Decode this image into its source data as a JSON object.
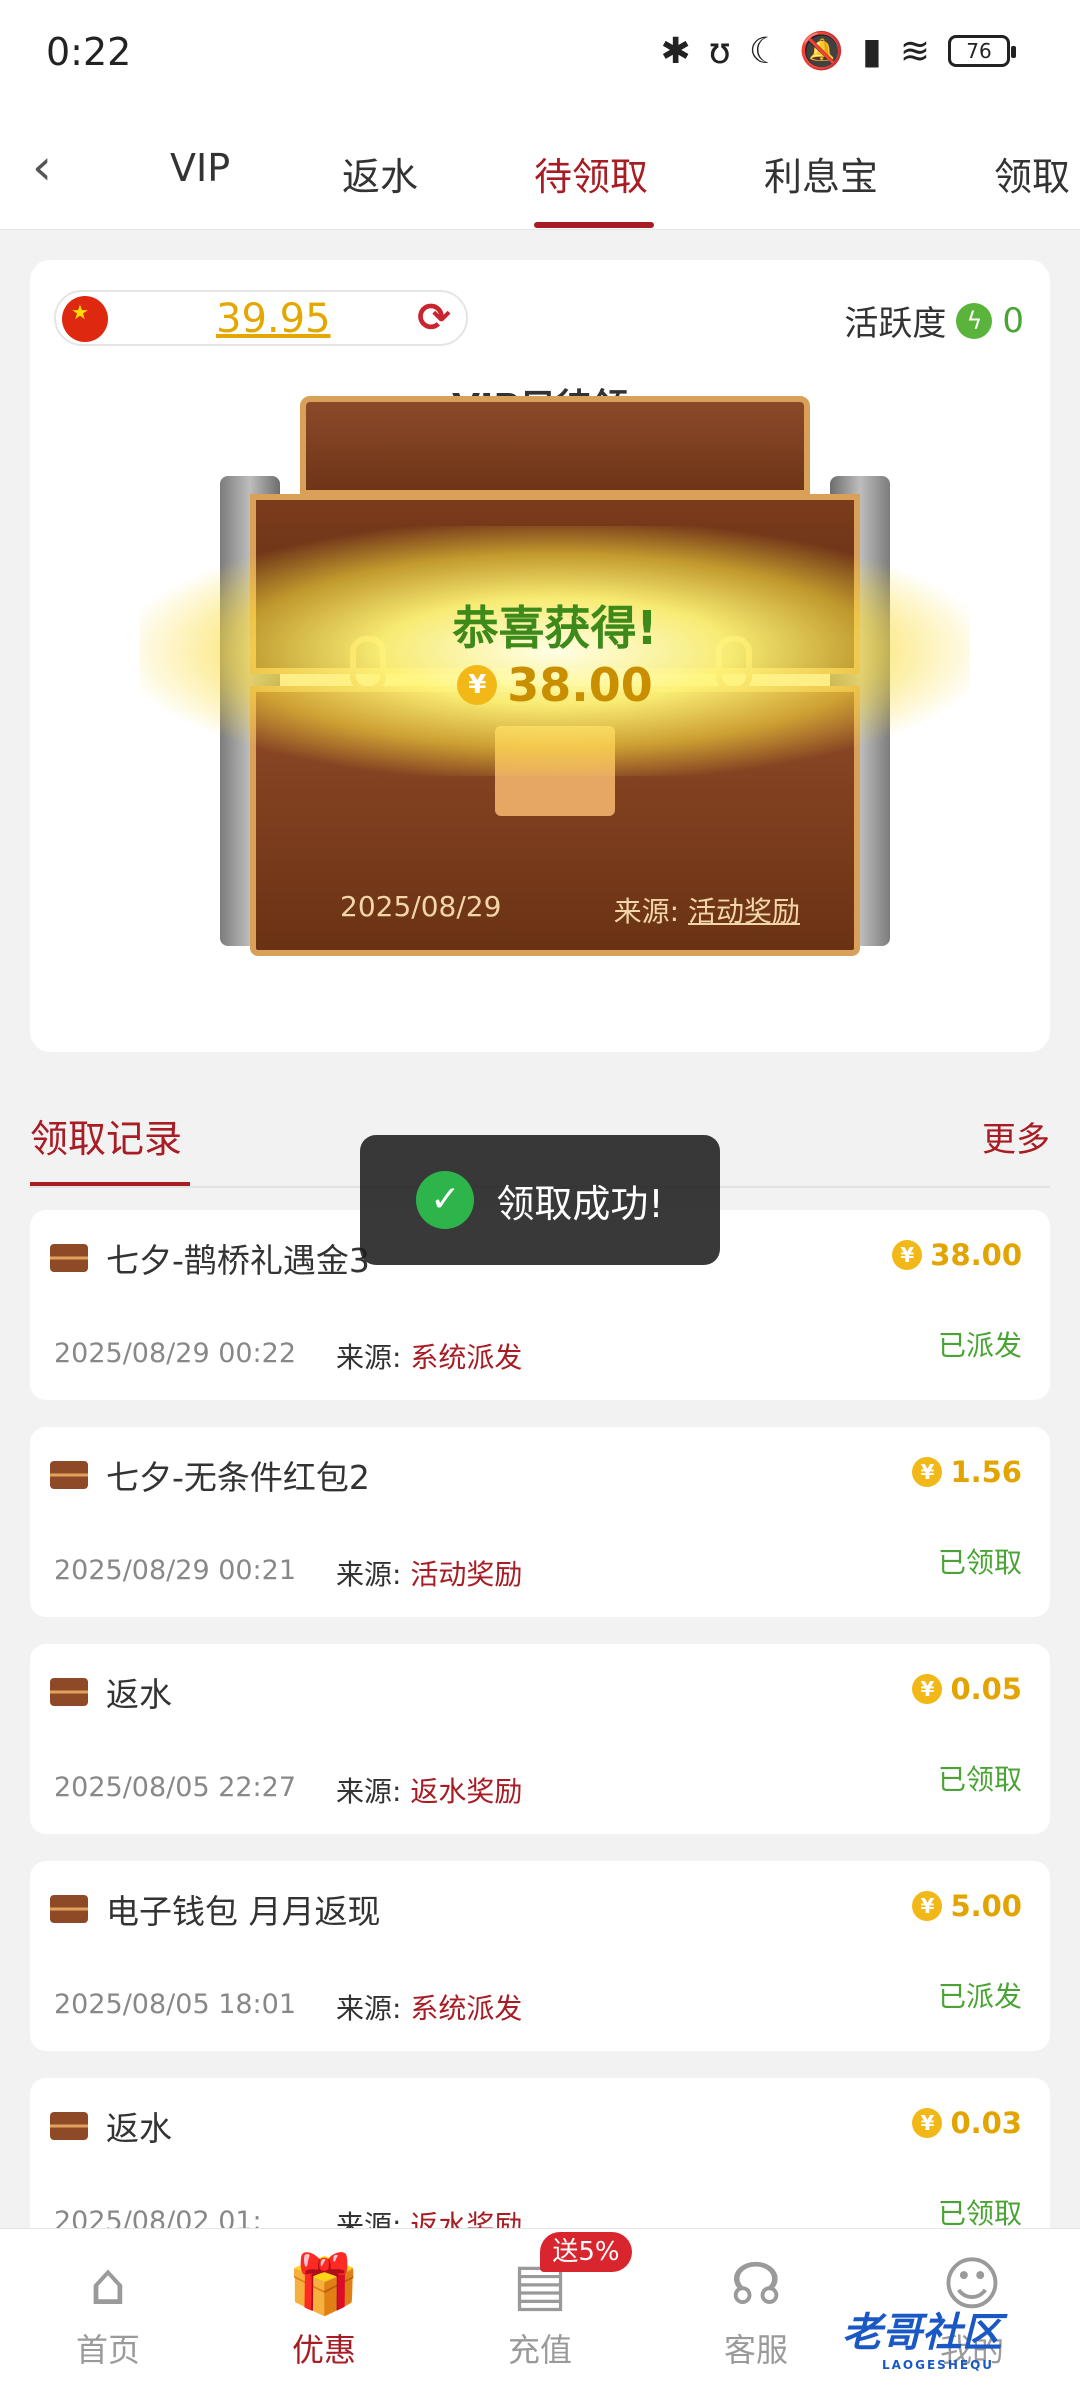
{
  "status_bar": {
    "time": "0:22",
    "battery": "76"
  },
  "nav": {
    "back_icon": "chevron-left-icon",
    "tabs": [
      {
        "label": "VIP"
      },
      {
        "label": "返水"
      },
      {
        "label": "待领取"
      },
      {
        "label": "利息宝"
      },
      {
        "label": "领取"
      }
    ],
    "active_tab": "待领取"
  },
  "card": {
    "balance": "39.95",
    "activity_label": "活跃度",
    "activity_value": "0",
    "vip_title": "VIP只待领",
    "congrats": "恭喜获得!",
    "prize_amount": "38.00",
    "date": "2025/08/29",
    "source_label": "来源:",
    "source_value": "活动奖励"
  },
  "records": {
    "title": "领取记录",
    "more": "更多",
    "items": [
      {
        "name": "七夕-鹊桥礼遇金3",
        "amount": "38.00",
        "time": "2025/08/29 00:22",
        "source_label": "来源:",
        "source": "系统派发",
        "status": "已派发"
      },
      {
        "name": "七夕-无条件红包2",
        "amount": "1.56",
        "time": "2025/08/29 00:21",
        "source_label": "来源:",
        "source": "活动奖励",
        "status": "已领取"
      },
      {
        "name": "返水",
        "amount": "0.05",
        "time": "2025/08/05 22:27",
        "source_label": "来源:",
        "source": "返水奖励",
        "status": "已领取"
      },
      {
        "name": "电子钱包 月月返现",
        "amount": "5.00",
        "time": "2025/08/05 18:01",
        "source_label": "来源:",
        "source": "系统派发",
        "status": "已派发"
      },
      {
        "name": "返水",
        "amount": "0.03",
        "time": "2025/08/02 01:",
        "source_label": "来源:",
        "source": "返水奖励",
        "status": "已领取"
      }
    ]
  },
  "toast": {
    "text": "领取成功!"
  },
  "bottom_nav": {
    "items": [
      {
        "label": "首页",
        "icon": "home-icon"
      },
      {
        "label": "优惠",
        "icon": "gift-icon"
      },
      {
        "label": "充值",
        "icon": "recharge-icon"
      },
      {
        "label": "客服",
        "icon": "headset-icon"
      },
      {
        "label": "我的",
        "icon": "user-icon"
      }
    ],
    "badge": "送5%"
  },
  "watermark": {
    "text": "老哥社区",
    "sub": "LAOGESHEQU"
  },
  "colors": {
    "accent": "#a81c24",
    "gold": "#e2a400",
    "green": "#4aa434"
  }
}
